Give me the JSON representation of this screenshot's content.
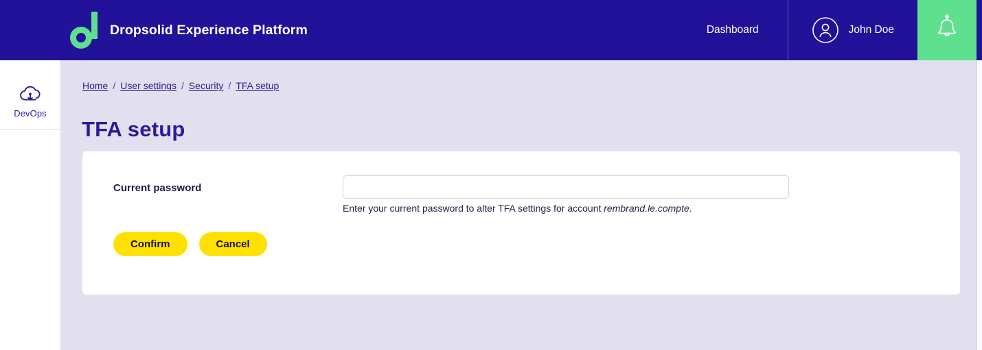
{
  "header": {
    "brand_title": "Dropsolid Experience Platform",
    "logo_icon": "dropsolid-d-logo",
    "nav": {
      "dashboard_label": "Dashboard"
    },
    "user": {
      "avatar_icon": "user-avatar-icon",
      "name": "John Doe"
    },
    "notifications": {
      "icon": "bell-icon"
    },
    "colors": {
      "background": "#211299",
      "accent_green": "#5ee08f",
      "text": "#ffffff"
    }
  },
  "sidebar": {
    "items": [
      {
        "label": "DevOps",
        "icon": "cloud-download-icon"
      }
    ]
  },
  "main": {
    "breadcrumb": {
      "separator": "/",
      "items": [
        {
          "label": "Home"
        },
        {
          "label": "User settings"
        },
        {
          "label": "Security"
        },
        {
          "label": "TFA setup"
        }
      ]
    },
    "page_title": "TFA setup",
    "card": {
      "field": {
        "label": "Current password",
        "value": "",
        "placeholder": "",
        "help_prefix": "Enter your current password to alter TFA settings for account ",
        "help_account": "rembrand.le.compte",
        "help_suffix": "."
      },
      "buttons": {
        "confirm_label": "Confirm",
        "cancel_label": "Cancel"
      }
    },
    "colors": {
      "page_background": "#e2e0ef",
      "card_background": "#ffffff",
      "title": "#2a1a9b",
      "button": "#ffe100",
      "button_text": "#14102e"
    }
  }
}
